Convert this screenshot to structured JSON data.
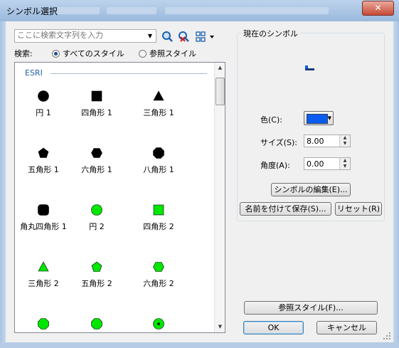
{
  "window": {
    "title": "シンボル選択",
    "close_label": "✕"
  },
  "search": {
    "placeholder": "ここに検索文字列を入力",
    "label": "検索:",
    "options": [
      "すべてのスタイル",
      "参照スタイル"
    ],
    "selected": "すべてのスタイル"
  },
  "gallery": {
    "group_name": "ESRI",
    "symbols": [
      {
        "label": "円 1",
        "shape": "circle",
        "color": "#000000"
      },
      {
        "label": "四角形 1",
        "shape": "square",
        "color": "#000000"
      },
      {
        "label": "三角形 1",
        "shape": "triangle",
        "color": "#000000"
      },
      {
        "label": "五角形 1",
        "shape": "pentagon",
        "color": "#000000"
      },
      {
        "label": "六角形 1",
        "shape": "hexagon",
        "color": "#000000"
      },
      {
        "label": "八角形 1",
        "shape": "octagon",
        "color": "#000000"
      },
      {
        "label": "角丸四角形 1",
        "shape": "rounded-square",
        "color": "#000000"
      },
      {
        "label": "円 2",
        "shape": "circle",
        "color": "#00e600"
      },
      {
        "label": "四角形 2",
        "shape": "square",
        "color": "#00e600"
      },
      {
        "label": "三角形 2",
        "shape": "triangle",
        "color": "#00e600"
      },
      {
        "label": "五角形 2",
        "shape": "pentagon",
        "color": "#00e600"
      },
      {
        "label": "六角形 2",
        "shape": "hexagon",
        "color": "#00e600"
      },
      {
        "label": "",
        "shape": "octagon",
        "color": "#00e600"
      },
      {
        "label": "",
        "shape": "octagon",
        "color": "#00e600"
      },
      {
        "label": "",
        "shape": "circle-dot",
        "color": "#00e600"
      }
    ]
  },
  "current_symbol": {
    "group_title": "現在のシンボル",
    "color_label": "色(C):",
    "color_value": "#0a5cf0",
    "size_label": "サイズ(S):",
    "size_value": "8.00",
    "angle_label": "角度(A):",
    "angle_value": "0.00",
    "edit_button": "シンボルの編集(E)...",
    "save_as_button": "名前を付けて保存(S)...",
    "reset_button": "リセット(R)"
  },
  "footer": {
    "style_ref_button": "参照スタイル(F)...",
    "ok_button": "OK",
    "cancel_button": "キャンセル"
  }
}
